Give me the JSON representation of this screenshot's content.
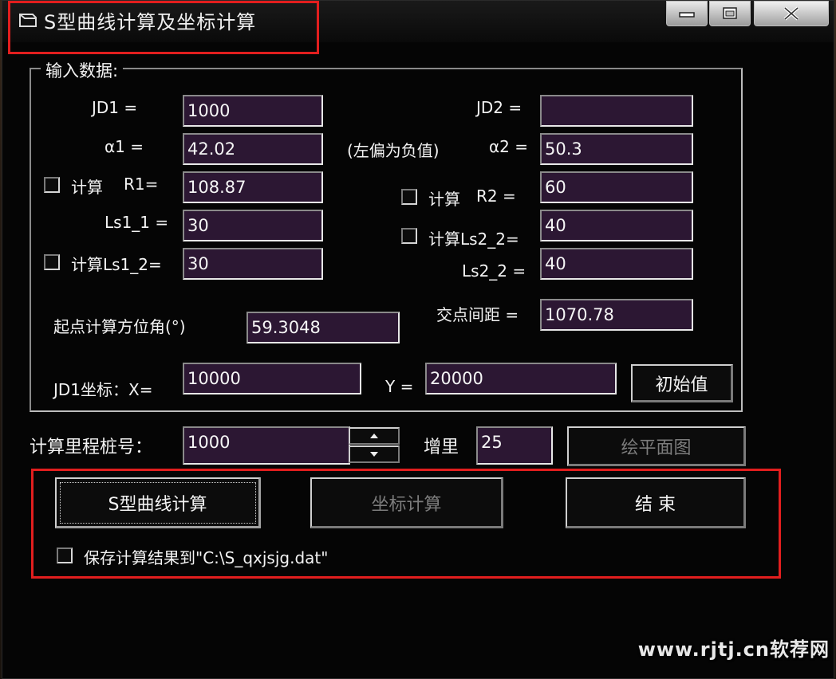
{
  "window": {
    "title": "S型曲线计算及坐标计算"
  },
  "input_group": {
    "legend": "输入数据:",
    "jd1_label": "JD1 =",
    "jd1_value": "1000",
    "jd2_label": "JD2 =",
    "jd2_value": "",
    "a1_label": "α1 =",
    "a1_value": "42.02",
    "left_negative_note": "(左偏为负值)",
    "a2_label": "α2 =",
    "a2_value": "50.3",
    "calc_r1_label": "计算",
    "r1_label": "R1=",
    "r1_value": "108.87",
    "calc_r2_label": "计算",
    "r2_label": "R2 =",
    "r2_value": "60",
    "ls1_1_label": "Ls1_1 =",
    "ls1_1_value": "30",
    "calc_ls2_2_label": "计算Ls2_2=",
    "ls2_2_top_value": "40",
    "calc_ls1_2_label": "计算Ls1_2=",
    "ls1_2_value": "30",
    "ls2_2_label": "Ls2_2 =",
    "ls2_2_value": "40",
    "start_azimuth_label": "起点计算方位角(°)",
    "start_azimuth_value": "59.3048",
    "intersection_distance_label": "交点间距 =",
    "intersection_distance_value": "1070.78",
    "jd1_coord_label": "JD1坐标：X=",
    "jd1_x_value": "10000",
    "y_label": "Y =",
    "jd1_y_value": "20000",
    "initial_button": "初始值"
  },
  "station": {
    "label": "计算里程桩号：",
    "value": "1000",
    "increment_label": "增里",
    "increment_value": "25",
    "draw_plan_button": "绘平面图"
  },
  "actions": {
    "s_curve_button": "S型曲线计算",
    "coord_button": "坐标计算",
    "end_button": "结 束",
    "save_result_label": "保存计算结果到\"C:\\S_qxjsjg.dat\""
  },
  "watermark": "www.rjtj.cn软荐网",
  "colors": {
    "field_bg": "#2c1733",
    "highlight": "#e21e1e",
    "window_bg": "#050505"
  }
}
